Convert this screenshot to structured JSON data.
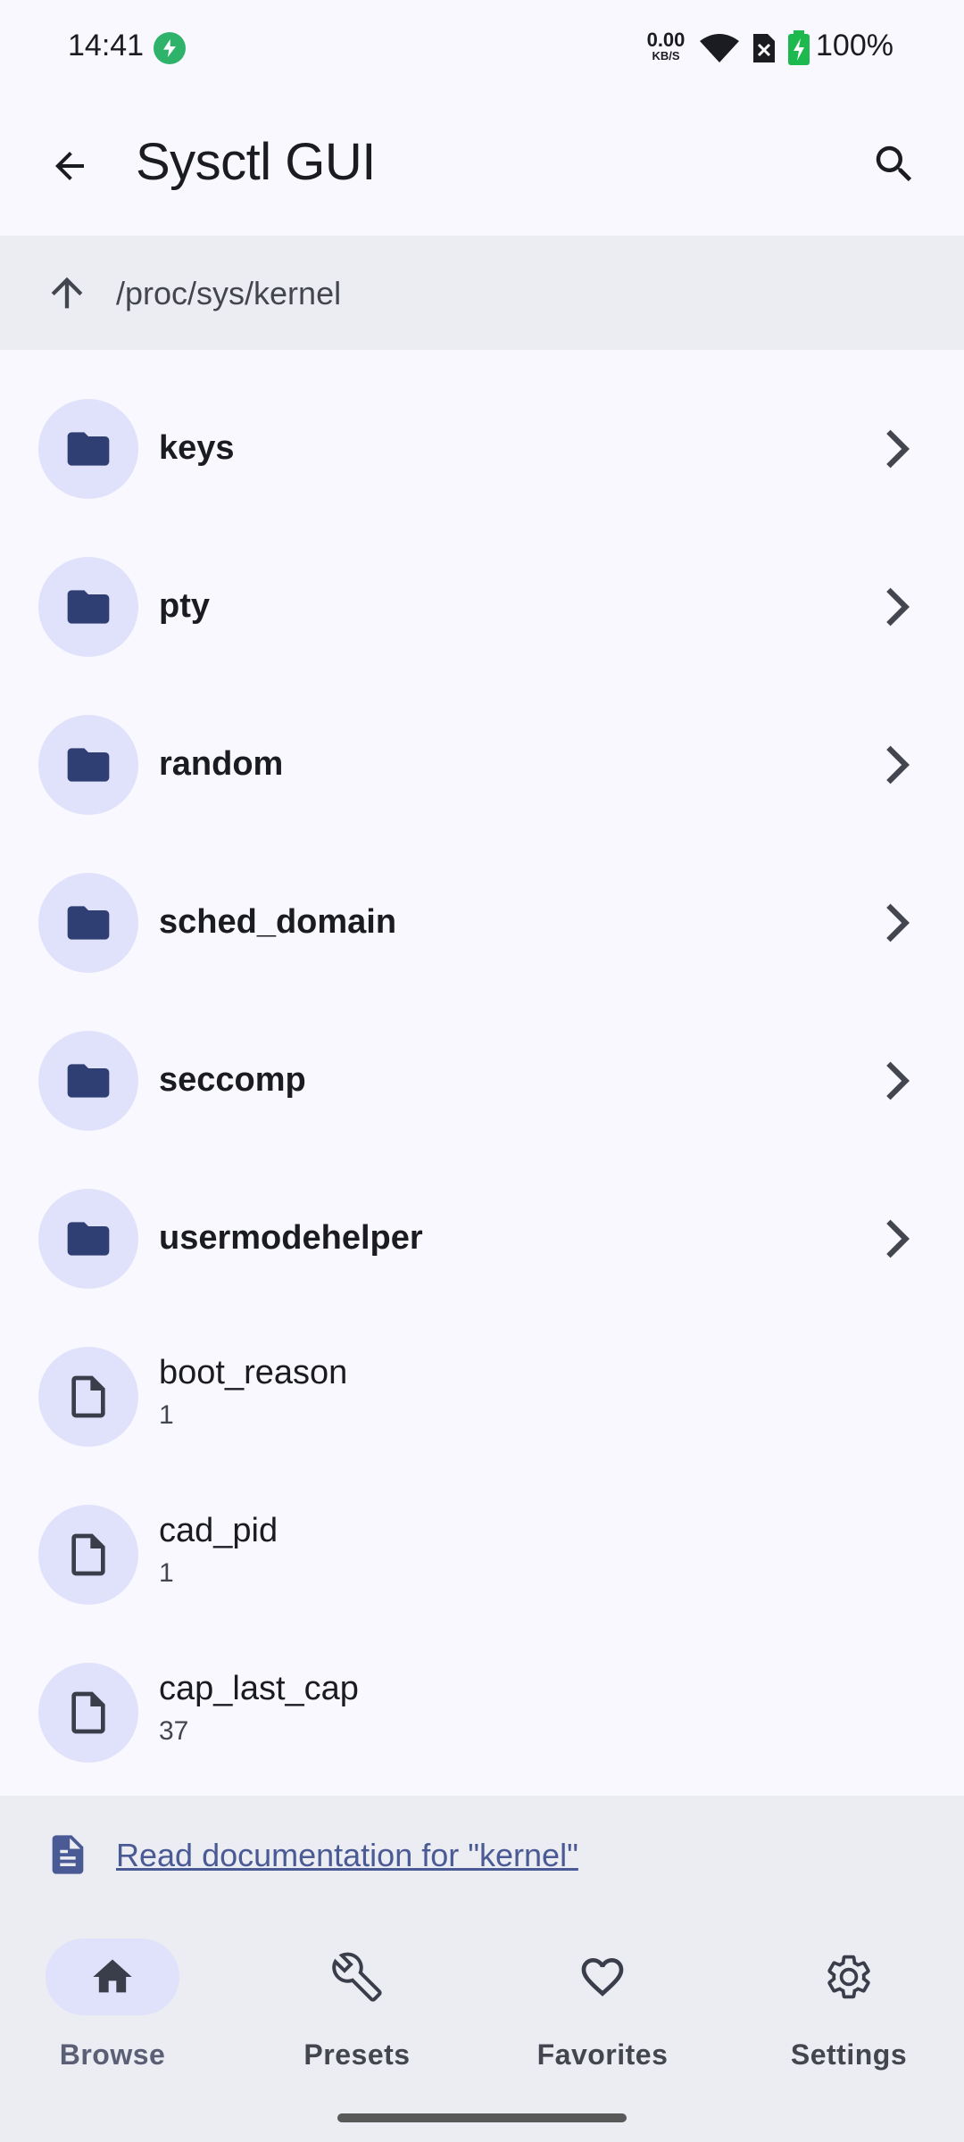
{
  "status_bar": {
    "time": "14:41",
    "net_speed_value": "0.00",
    "net_speed_unit": "KB/S",
    "battery_percent": "100%"
  },
  "app_bar": {
    "title": "Sysctl GUI",
    "back_icon": "arrow-back-icon",
    "search_icon": "search-icon"
  },
  "path_bar": {
    "path": "/proc/sys/kernel",
    "up_icon": "arrow-up-icon"
  },
  "folders": [
    {
      "name": "keys"
    },
    {
      "name": "pty"
    },
    {
      "name": "random"
    },
    {
      "name": "sched_domain"
    },
    {
      "name": "seccomp"
    },
    {
      "name": "usermodehelper"
    }
  ],
  "files": [
    {
      "name": "boot_reason",
      "value": "1"
    },
    {
      "name": "cad_pid",
      "value": "1"
    },
    {
      "name": "cap_last_cap",
      "value": "37"
    }
  ],
  "doc_link": {
    "label": "Read documentation for \"kernel\""
  },
  "bottom_nav": [
    {
      "label": "Browse",
      "icon": "home-icon",
      "active": true
    },
    {
      "label": "Presets",
      "icon": "wrench-icon",
      "active": false
    },
    {
      "label": "Favorites",
      "icon": "heart-icon",
      "active": false
    },
    {
      "label": "Settings",
      "icon": "gear-icon",
      "active": false
    }
  ],
  "colors": {
    "background": "#F8F8FE",
    "surface_variant": "#ECECF3",
    "avatar_bg": "#DFE2FA",
    "folder_icon": "#2F3F73",
    "link": "#4A5A94"
  }
}
